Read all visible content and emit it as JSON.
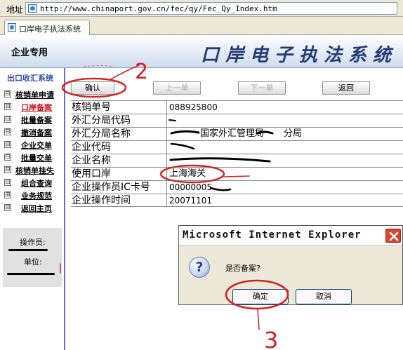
{
  "browser": {
    "address_label": "地址",
    "url": "http://www.chinaport.gov.cn/fec/qy/Fec_Qy_Index.htm",
    "tab_title": "口岸电子执法系统"
  },
  "header": {
    "left_label": "企业专用",
    "system_title": "口岸电子执法系统"
  },
  "sidebar": {
    "title": "出口收汇系统",
    "items": [
      {
        "label": "核销单申请",
        "marker": "⊟"
      },
      {
        "label": "口岸备案",
        "marker": "⊟"
      },
      {
        "label": "批量备案",
        "marker": "⊟"
      },
      {
        "label": "撤消备案",
        "marker": "⊟"
      },
      {
        "label": "企业交单",
        "marker": "⊟"
      },
      {
        "label": "批量交单",
        "marker": "⊟"
      },
      {
        "label": "核销单挂失",
        "marker": "⊟"
      },
      {
        "label": "组合查询",
        "marker": "⊟"
      },
      {
        "label": "业务规范",
        "marker": "⊞"
      },
      {
        "label": "返回主页",
        "marker": "⊟"
      }
    ],
    "operator_label": "操作员:",
    "unit_label": "单位:"
  },
  "toolbar": {
    "confirm": "确认",
    "prev": "上一单",
    "next": "下一单",
    "back": "返回"
  },
  "form": {
    "rows": [
      {
        "label": "核销单号",
        "value": "088925800"
      },
      {
        "label": "外汇分局代码",
        "value": ""
      },
      {
        "label": "外汇分局名称",
        "value": "国家外汇管理局",
        "suffix": "分局"
      },
      {
        "label": "企业代码",
        "value": ""
      },
      {
        "label": "企业名称",
        "value": ""
      },
      {
        "label": "使用口岸",
        "value": "上海海关"
      },
      {
        "label": "企业操作员IC卡号",
        "value": "00000005"
      },
      {
        "label": "企业操作时间",
        "value": "20071101"
      }
    ]
  },
  "dialog": {
    "title": "Microsoft Internet Explorer",
    "message": "是否备案?",
    "icon_glyph": "?",
    "ok": "确定",
    "cancel": "取消"
  },
  "annotations": {
    "step_2": "2",
    "step_3": "3"
  },
  "colors": {
    "annotation_red": "#d42020",
    "header_title_blue": "#223a75",
    "active_item_red": "#c4141e"
  }
}
